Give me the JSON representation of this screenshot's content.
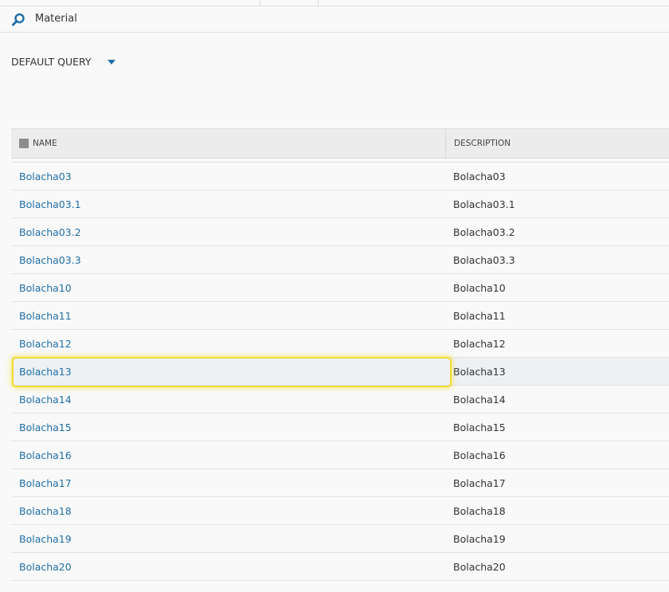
{
  "search": {
    "label": "Material",
    "icon": "search-icon"
  },
  "query": {
    "label": "DEFAULT QUERY"
  },
  "table": {
    "columns": [
      "NAME",
      "DESCRIPTION"
    ],
    "rows": [
      {
        "name": "Bolacha03",
        "description": "Bolacha03"
      },
      {
        "name": "Bolacha03.1",
        "description": "Bolacha03.1"
      },
      {
        "name": "Bolacha03.2",
        "description": "Bolacha03.2"
      },
      {
        "name": "Bolacha03.3",
        "description": "Bolacha03.3"
      },
      {
        "name": "Bolacha10",
        "description": "Bolacha10"
      },
      {
        "name": "Bolacha11",
        "description": "Bolacha11"
      },
      {
        "name": "Bolacha12",
        "description": "Bolacha12"
      },
      {
        "name": "Bolacha13",
        "description": "Bolacha13"
      },
      {
        "name": "Bolacha14",
        "description": "Bolacha14"
      },
      {
        "name": "Bolacha15",
        "description": "Bolacha15"
      },
      {
        "name": "Bolacha16",
        "description": "Bolacha16"
      },
      {
        "name": "Bolacha17",
        "description": "Bolacha17"
      },
      {
        "name": "Bolacha18",
        "description": "Bolacha18"
      },
      {
        "name": "Bolacha19",
        "description": "Bolacha19"
      },
      {
        "name": "Bolacha20",
        "description": "Bolacha20"
      }
    ],
    "selected_index": 7
  },
  "colors": {
    "link": "#1f6fa8",
    "highlight": "#f2dc2e"
  }
}
